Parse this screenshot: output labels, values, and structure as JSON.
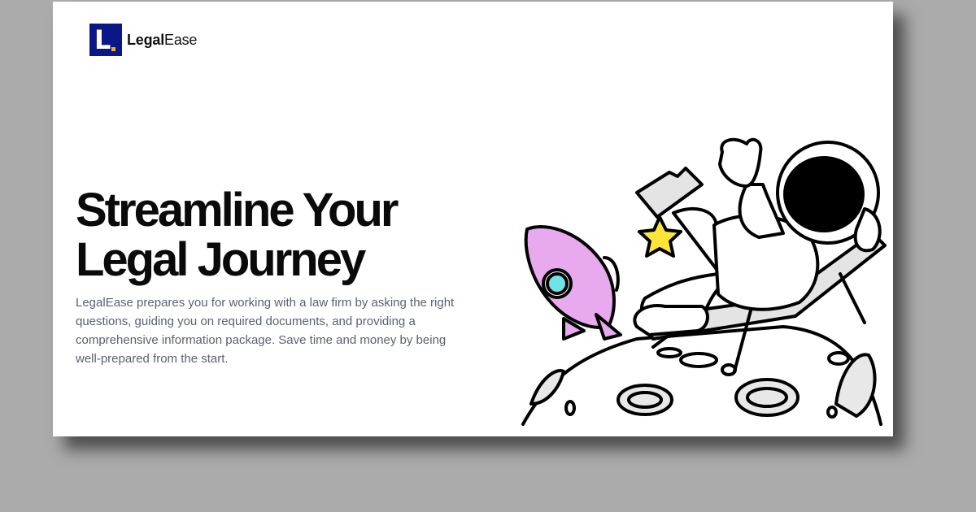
{
  "brand": {
    "logo_letter": "L",
    "name_bold": "Legal",
    "name_regular": "Ease",
    "logo_color": "#0b1787",
    "logo_dot_color": "#f5a623"
  },
  "hero": {
    "headline_line1": "Streamline Your",
    "headline_line2": "Legal Journey",
    "description": "LegalEase prepares you for working with a law firm by asking the right questions, guiding you on required documents, and providing a comprehensive information package. Save time and money by being well-prepared from the start."
  },
  "illustration": {
    "icon": "astronaut-relaxing-on-moon-illustration",
    "rocket_color": "#e9a9ee",
    "rocket_window_color": "#6fe3e6",
    "star_color": "#ffe53a"
  }
}
